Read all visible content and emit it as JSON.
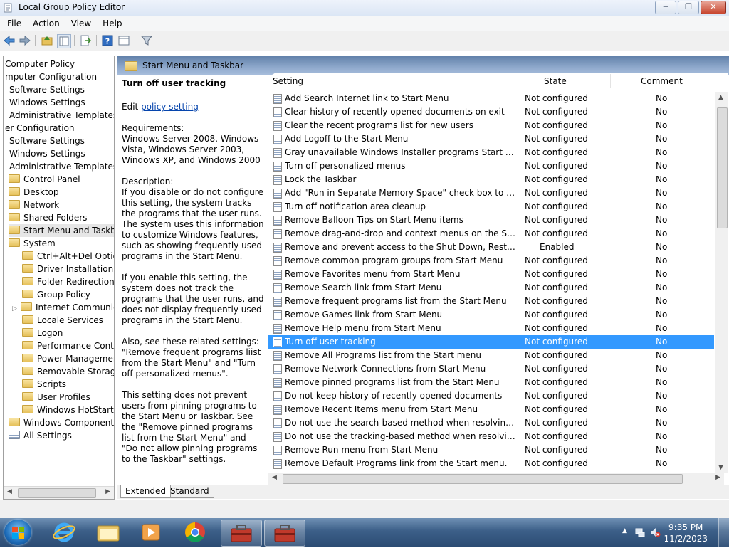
{
  "window": {
    "title": "Local Group Policy Editor"
  },
  "menu": [
    "File",
    "Action",
    "View",
    "Help"
  ],
  "tree": [
    {
      "label": "Computer Policy",
      "x": 2,
      "folder": false
    },
    {
      "label": "mputer Configuration",
      "x": 2,
      "folder": false
    },
    {
      "label": "Software Settings",
      "x": 8,
      "folder": false
    },
    {
      "label": "Windows Settings",
      "x": 8,
      "folder": false
    },
    {
      "label": "Administrative Templates",
      "x": 8,
      "folder": false
    },
    {
      "label": "er Configuration",
      "x": 2,
      "folder": false
    },
    {
      "label": "Software Settings",
      "x": 8,
      "folder": false
    },
    {
      "label": "Windows Settings",
      "x": 8,
      "folder": false
    },
    {
      "label": "Administrative Templates",
      "x": 8,
      "folder": false
    },
    {
      "label": "Control Panel",
      "x": 7,
      "folder": true
    },
    {
      "label": "Desktop",
      "x": 7,
      "folder": true
    },
    {
      "label": "Network",
      "x": 7,
      "folder": true
    },
    {
      "label": "Shared Folders",
      "x": 7,
      "folder": true
    },
    {
      "label": "Start Menu and Taskbar",
      "x": 7,
      "folder": true,
      "selected": true
    },
    {
      "label": "System",
      "x": 7,
      "folder": true
    },
    {
      "label": "Ctrl+Alt+Del Options",
      "x": 26,
      "folder": true
    },
    {
      "label": "Driver Installation",
      "x": 26,
      "folder": true
    },
    {
      "label": "Folder Redirection",
      "x": 26,
      "folder": true
    },
    {
      "label": "Group Policy",
      "x": 26,
      "folder": true
    },
    {
      "label": "Internet Communication",
      "x": 26,
      "folder": true,
      "expandable": true
    },
    {
      "label": "Locale Services",
      "x": 26,
      "folder": true
    },
    {
      "label": "Logon",
      "x": 26,
      "folder": true
    },
    {
      "label": "Performance Control",
      "x": 26,
      "folder": true
    },
    {
      "label": "Power Management",
      "x": 26,
      "folder": true
    },
    {
      "label": "Removable Storage Access",
      "x": 26,
      "folder": true
    },
    {
      "label": "Scripts",
      "x": 26,
      "folder": true
    },
    {
      "label": "User Profiles",
      "x": 26,
      "folder": true
    },
    {
      "label": "Windows HotStart",
      "x": 26,
      "folder": true
    },
    {
      "label": "Windows Components",
      "x": 7,
      "folder": true
    },
    {
      "label": "All Settings",
      "x": 7,
      "folder": false,
      "allsettings": true
    }
  ],
  "header": {
    "title": "Start Menu and Taskbar"
  },
  "description": {
    "title": "Turn off user tracking",
    "edit_prefix": "Edit ",
    "edit_link": "policy setting",
    "requirements": "Requirements:\nWindows Server 2008, Windows Vista, Windows Server 2003, Windows XP, and Windows 2000",
    "desc1": "Description:\nIf you disable or do not configure this setting, the system tracks the programs that the user runs. The system uses this information to customize Windows features, such as showing frequently used programs in the Start Menu.",
    "desc2": "If you enable this setting, the system does not track the programs that the user runs, and does not display frequently used programs in the Start Menu.",
    "desc3": "Also, see these related settings: \"Remove frequent programs liist from the Start Menu\" and \"Turn off personalized menus\".",
    "desc4": "This setting does not prevent users from pinning programs to the Start Menu or Taskbar. See the \"Remove pinned programs list from the Start Menu\" and \"Do not allow pinning programs to the Taskbar\" settings."
  },
  "columns": {
    "setting": "Setting",
    "state": "State",
    "comment": "Comment"
  },
  "rows": [
    {
      "setting": "Add Search Internet link to Start Menu",
      "state": "Not configured",
      "comment": "No"
    },
    {
      "setting": "Clear history of recently opened documents on exit",
      "state": "Not configured",
      "comment": "No"
    },
    {
      "setting": "Clear the recent programs list for new users",
      "state": "Not configured",
      "comment": "No"
    },
    {
      "setting": "Add Logoff to the Start Menu",
      "state": "Not configured",
      "comment": "No"
    },
    {
      "setting": "Gray unavailable Windows Installer programs Start Menu sh...",
      "state": "Not configured",
      "comment": "No"
    },
    {
      "setting": "Turn off personalized menus",
      "state": "Not configured",
      "comment": "No"
    },
    {
      "setting": "Lock the Taskbar",
      "state": "Not configured",
      "comment": "No"
    },
    {
      "setting": "Add \"Run in Separate Memory Space\" check box to Run dial...",
      "state": "Not configured",
      "comment": "No"
    },
    {
      "setting": "Turn off notification area cleanup",
      "state": "Not configured",
      "comment": "No"
    },
    {
      "setting": "Remove Balloon Tips on Start Menu items",
      "state": "Not configured",
      "comment": "No"
    },
    {
      "setting": "Remove drag-and-drop and context menus on the Start Me...",
      "state": "Not configured",
      "comment": "No"
    },
    {
      "setting": "Remove and prevent access to the Shut Down, Restart, Sleep...",
      "state": "Enabled",
      "comment": "No"
    },
    {
      "setting": "Remove common program groups from Start Menu",
      "state": "Not configured",
      "comment": "No"
    },
    {
      "setting": "Remove Favorites menu from Start Menu",
      "state": "Not configured",
      "comment": "No"
    },
    {
      "setting": "Remove Search link from Start Menu",
      "state": "Not configured",
      "comment": "No"
    },
    {
      "setting": "Remove frequent programs list from the Start Menu",
      "state": "Not configured",
      "comment": "No"
    },
    {
      "setting": "Remove Games link from Start Menu",
      "state": "Not configured",
      "comment": "No"
    },
    {
      "setting": "Remove Help menu from Start Menu",
      "state": "Not configured",
      "comment": "No"
    },
    {
      "setting": "Turn off user tracking",
      "state": "Not configured",
      "comment": "No",
      "selected": true
    },
    {
      "setting": "Remove All Programs list from the Start menu",
      "state": "Not configured",
      "comment": "No"
    },
    {
      "setting": "Remove Network Connections from Start Menu",
      "state": "Not configured",
      "comment": "No"
    },
    {
      "setting": "Remove pinned programs list from the Start Menu",
      "state": "Not configured",
      "comment": "No"
    },
    {
      "setting": "Do not keep history of recently opened documents",
      "state": "Not configured",
      "comment": "No"
    },
    {
      "setting": "Remove Recent Items menu from Start Menu",
      "state": "Not configured",
      "comment": "No"
    },
    {
      "setting": "Do not use the search-based method when resolving shell s...",
      "state": "Not configured",
      "comment": "No"
    },
    {
      "setting": "Do not use the tracking-based method when resolving shell ...",
      "state": "Not configured",
      "comment": "No"
    },
    {
      "setting": "Remove Run menu from Start Menu",
      "state": "Not configured",
      "comment": "No"
    },
    {
      "setting": "Remove Default Programs link from the Start menu.",
      "state": "Not configured",
      "comment": "No"
    }
  ],
  "tabs": {
    "extended": "Extended",
    "standard": "Standard"
  },
  "taskbar": {
    "time": "9:35 PM",
    "date": "11/2/2023"
  },
  "colors": {
    "selection": "#3399ff",
    "header_gradient": "#5f7fa8",
    "taskbar": "#3c5f88"
  }
}
